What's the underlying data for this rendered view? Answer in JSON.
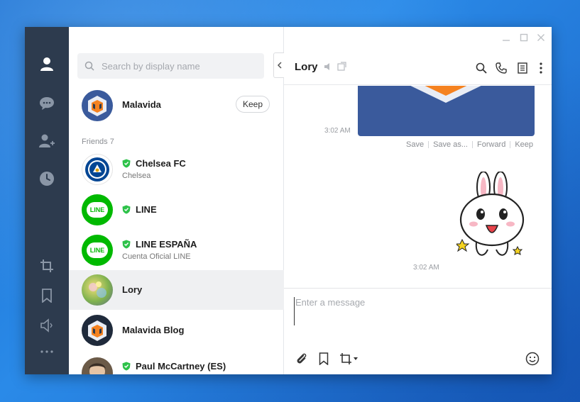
{
  "search": {
    "placeholder": "Search by display name"
  },
  "pinned": {
    "name": "Malavida",
    "keep_label": "Keep"
  },
  "friends_section": {
    "label": "Friends 7"
  },
  "friends": [
    {
      "name": "Chelsea FC",
      "sub": "Chelsea",
      "official": true
    },
    {
      "name": "LINE",
      "sub": "",
      "official": true
    },
    {
      "name": "LINE ESPAÑA",
      "sub": "Cuenta Oficial LINE",
      "official": true
    },
    {
      "name": "Lory",
      "sub": "",
      "official": false,
      "selected": true
    },
    {
      "name": "Malavida Blog",
      "sub": "",
      "official": false
    },
    {
      "name": "Paul McCartney (ES)",
      "sub": "",
      "official": true
    }
  ],
  "chat": {
    "title": "Lory",
    "messages": [
      {
        "type": "image",
        "time": "3:02 AM",
        "actions": [
          "Save",
          "Save as...",
          "Forward",
          "Keep"
        ]
      },
      {
        "type": "sticker",
        "time": "3:02 AM"
      }
    ],
    "composer_placeholder": "Enter a message"
  },
  "avatar_texts": {
    "line": "LINE"
  },
  "colors": {
    "rail": "#2d3b4e",
    "line_green": "#00b900",
    "shield_green": "#2ec24a",
    "malavida_orange": "#f58220",
    "malavida_blue": "#3a5a9c"
  },
  "icons": {
    "rail": [
      "person-icon",
      "chat-icon",
      "add-friend-icon",
      "clock-icon",
      "crop-icon",
      "bookmark-icon",
      "speaker-icon",
      "more-icon"
    ],
    "header": [
      "search-icon",
      "phone-icon",
      "notes-icon",
      "kebab-icon"
    ],
    "composer": [
      "paperclip-icon",
      "bookmark-icon",
      "crop-icon",
      "emoji-icon"
    ]
  }
}
